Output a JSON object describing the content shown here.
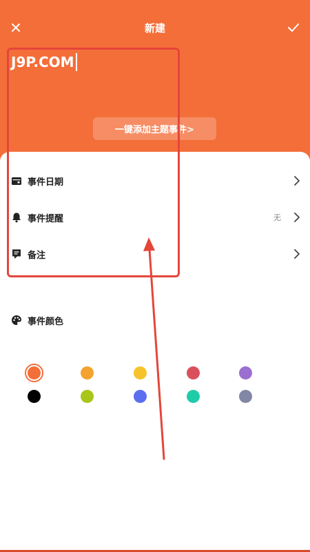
{
  "header": {
    "title": "新建",
    "event_name": "J9P.COM",
    "theme_button_label": "一键添加主题事件>"
  },
  "rows": [
    {
      "label": "事件日期",
      "value": "",
      "icon": "calendar-icon"
    },
    {
      "label": "事件提醒",
      "value": "无",
      "icon": "bell-icon"
    },
    {
      "label": "备注",
      "value": "",
      "icon": "note-icon"
    }
  ],
  "color_section": {
    "label": "事件颜色",
    "icon": "palette-icon",
    "selected_index": 0,
    "colors": [
      "#f46e3a",
      "#f4a22f",
      "#f6c42a",
      "#d9505c",
      "#9b6fd0",
      "#000000",
      "#a8c51a",
      "#5a6ff0",
      "#1fcca8",
      "#8287a6"
    ]
  },
  "colors": {
    "accent": "#f46e3a",
    "annotation": "#e4463a"
  }
}
